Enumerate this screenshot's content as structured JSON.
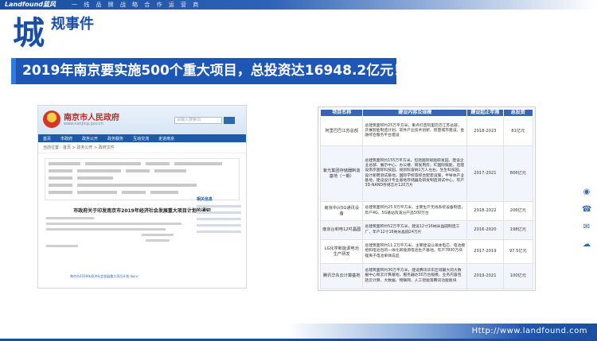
{
  "header": {
    "brand": "Landfound蓝风",
    "slogan": "一 线 品 牌 战 略 合 作 运 营 商"
  },
  "title": {
    "big": "城",
    "small": "规事件"
  },
  "headline": "2019年南京要实施500个重大项目，总投资达16948.2亿元！",
  "screenshot": {
    "site_name": "南京市人民政府",
    "site_url": "www.nanjing.gov.cn",
    "search_placeholder": "请输入搜索词",
    "nav_items": [
      "首页",
      "市政府",
      "政务公开",
      "政务服务",
      "互动交流",
      "走进南京"
    ],
    "breadcrumb": "当前位置：首页 > 政务公开 > 政府文件",
    "doc_title": "市政府关于印发南京市2019年经济社会发展重大项目计划的通知",
    "side_title": "相关信息",
    "attachment": "南京市2019年经济社会发展重大项目计划.docx"
  },
  "table": {
    "headers": [
      "项目名称",
      "建设内容及规模",
      "建设起止年限",
      "总投资"
    ],
    "rows": [
      {
        "name": "阿里巴巴江苏总部",
        "content": "总建筑面积约25万平方米，重点打造阿里巴巴江苏总部，开展智能制造计划、软件产业技术创新、智慧城市建设、金融综合服务平台建设",
        "years": "2018-2023",
        "amount": "81亿元"
      },
      {
        "name": "紫光集团存储器制造基地（一期）",
        "content": "总建筑面积约155万平方米，包括国际赋能研发园、建设企业总部、展示中心、办公楼、研发用房，IC国际赋能、后建设南京国际科技园，规划科容纳1万人左右，生生科技园，设计新聘测试基地，国际学校等综合配套设施，半导体产业基地，建设设计专业基地存储器及研发制造测试中心，年产3D-NAND存储芯片120万片",
        "years": "2017-2021",
        "amount": "806亿元"
      },
      {
        "name": "南京中兴5G通讯设备",
        "content": "总建筑面积约25.9万平方米，主要生产无线系统设备制造，年产4G、5G基站及波分产品500万台",
        "years": "2018-2022",
        "amount": "206亿元"
      },
      {
        "name": "南京台积电12吋晶圆",
        "content": "总建筑面积约52万平方米，建设12寸16纳米晶圆制造工厂，年产12寸16纳米晶圆24万片",
        "years": "2016-2020",
        "amount": "198亿元"
      },
      {
        "name": "LG化学新能源电池生产研发",
        "content": "总建筑面积约11.2万平方米，主要建设以单体电芯、电池模组和电池包的一体化新能源电池生产基地，年产7800万块锂离子电池单体成品",
        "years": "2017-2019",
        "amount": "97.5亿元"
      },
      {
        "name": "腾讯华东云计算基地",
        "content": "总建筑面积约30万平方米，建设腾讯华东区域最大的大数据中心和云计算基地，服务器达30万台规模，业务内容包括云计算、大数据、物联网、人工智能等腾讯功能板块",
        "years": "2019-2021",
        "amount": "100亿元"
      }
    ]
  },
  "footer": {
    "url": "Http://www.landfound.com"
  }
}
